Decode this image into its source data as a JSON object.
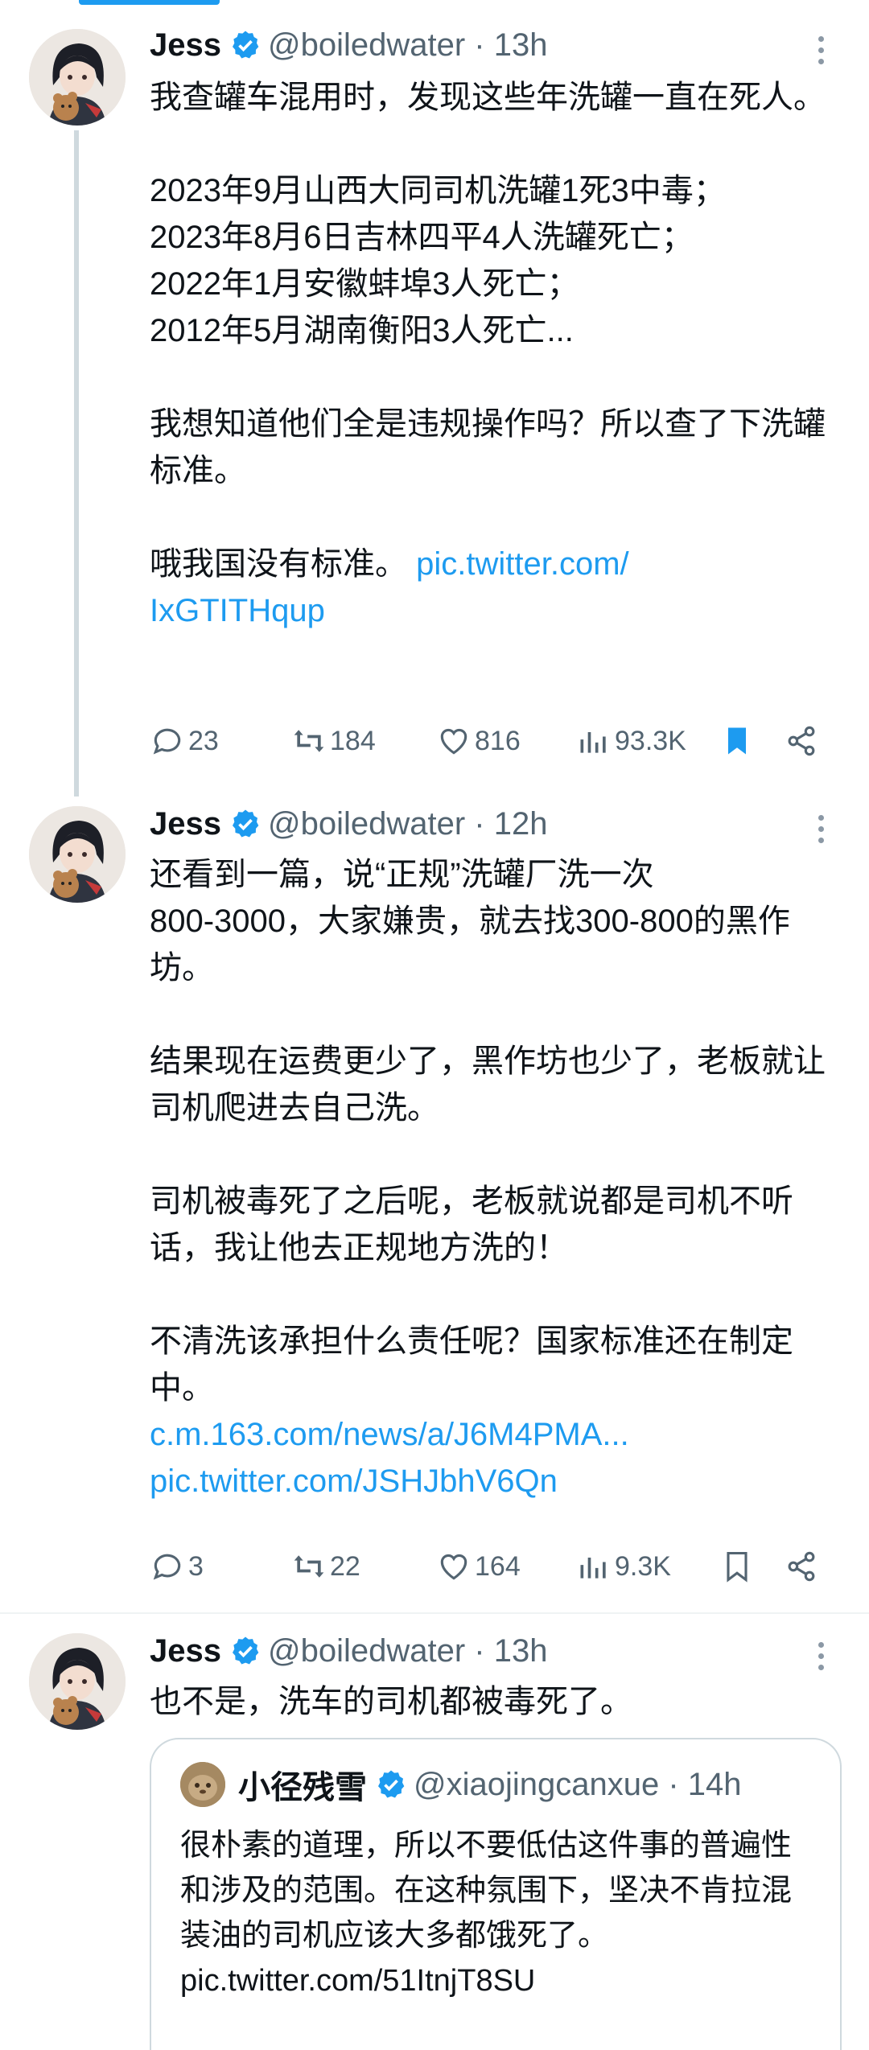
{
  "tweets": [
    {
      "name": "Jess",
      "handle": "@boiledwater · 13h",
      "text": "我查罐车混用时，发现这些年洗罐一直在死人。\n\n2023年9月山西大同司机洗罐1死3中毒；\n2023年8月6日吉林四平4人洗罐死亡；\n2022年1月安徽蚌埠3人死亡；\n2012年5月湖南衡阳3人死亡...\n\n我想知道他们全是违规操作吗？所以查了下洗罐标准。\n\n哦我国没有标准。",
      "links": [
        "pic.twitter.com/",
        "IxGTITHqup"
      ],
      "replies": "23",
      "retweets": "184",
      "likes": "816",
      "views": "93.3K",
      "bookmarked": true
    },
    {
      "name": "Jess",
      "handle": "@boiledwater · 12h",
      "text": "还看到一篇，说“正规”洗罐厂洗一次\n800-3000，大家嫌贵，就去找300-800的黑作坊。\n\n结果现在运费更少了，黑作坊也少了，老板就让司机爬进去自己洗。\n\n司机被毒死了之后呢，老板就说都是司机不听话，我让他去正规地方洗的！\n\n不清洗该承担什么责任呢？国家标准还在制定中。",
      "links": [
        "c.m.163.com/news/a/J6M4PMA...",
        "pic.twitter.com/JSHJbhV6Qn"
      ],
      "replies": "3",
      "retweets": "22",
      "likes": "164",
      "views": "9.3K",
      "bookmarked": false
    },
    {
      "name": "Jess",
      "handle": "@boiledwater · 13h",
      "text": "也不是，洗车的司机都被毒死了。"
    }
  ],
  "quote": {
    "name": "小径残雪",
    "handle": "@xiaojingcanxue · 14h",
    "text": "很朴素的道理，所以不要低估这件事的普遍性和涉及的范围。在这种氛围下，坚决不肯拉混装油的司机应该大多都饿死了。",
    "link": "pic.twitter.com/51ItnjT8SU"
  },
  "colors": {
    "accent": "#1d9bf0",
    "muted": "#536471",
    "text": "#0f1419",
    "border": "#cfd9de"
  },
  "icons": [
    "verified-badge-icon",
    "more-icon",
    "reply-icon",
    "retweet-icon",
    "like-icon",
    "views-icon",
    "bookmark-icon",
    "share-icon"
  ]
}
